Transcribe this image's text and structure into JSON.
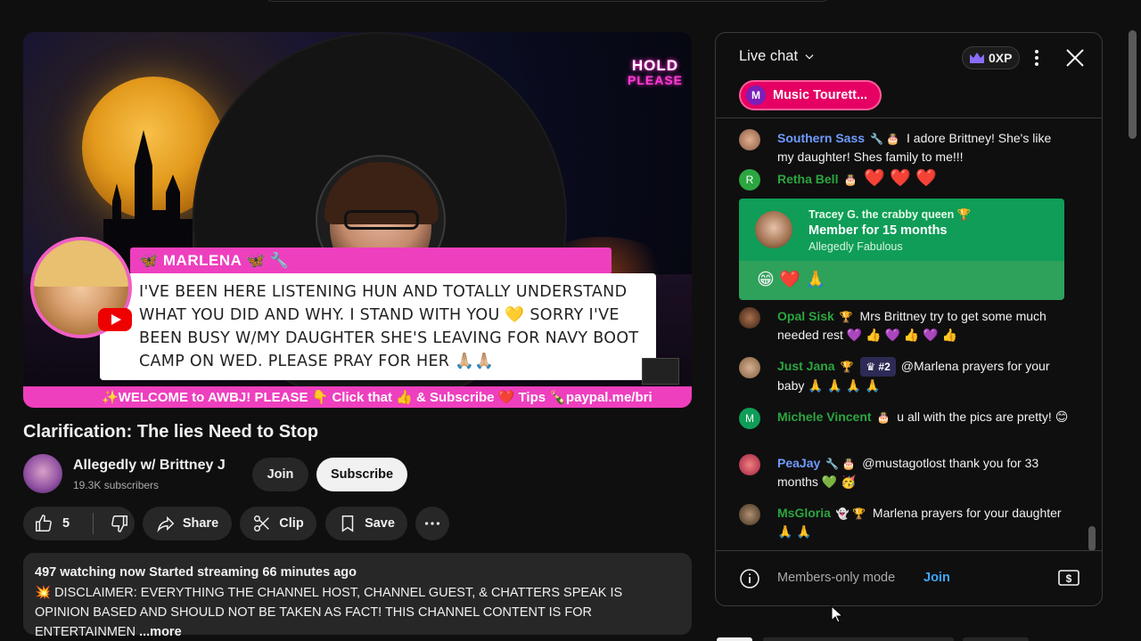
{
  "video": {
    "hold_line1": "HOLD",
    "hold_line2": "PLEASE",
    "overlay_name": "🦋 MARLENA 🦋 🔧",
    "overlay_message": "I'VE BEEN HERE LISTENING HUN AND TOTALLY UNDERSTAND WHAT YOU DID AND WHY. I STAND WITH YOU 💛 SORRY I'VE BEEN BUSY W/MY DAUGHTER SHE'S LEAVING FOR NAVY BOOT CAMP ON WED. PLEASE PRAY FOR HER 🙏🏼🙏🏼",
    "ticker": "✨WELCOME to AWBJ! PLEASE 👇 Click that 👍 & Subscribe ❤️ Tips 🍾paypal.me/bri"
  },
  "title": "Clarification: The lies Need to Stop",
  "channel": {
    "name": "Allegedly w/ Brittney J",
    "subscribers": "19.3K subscribers",
    "join_label": "Join",
    "subscribe_label": "Subscribe"
  },
  "actions": {
    "likes": "5",
    "share_label": "Share",
    "clip_label": "Clip",
    "save_label": "Save"
  },
  "description": {
    "meta": "497 watching now  Started streaming 66 minutes ago",
    "body": "💥 DISCLAIMER: EVERYTHING THE CHANNEL HOST, CHANNEL GUEST, & CHATTERS SPEAK IS OPINION BASED AND SHOULD NOT BE TAKEN AS FACT!  THIS CHANNEL CONTENT IS FOR ENTERTAINMEN",
    "more": "...more"
  },
  "chat": {
    "title": "Live chat",
    "xp": "0XP",
    "pinned": "Music Tourett...",
    "pinned_initial": "M",
    "messages": [
      {
        "author": "Southern Sass",
        "badges": "🔧 🎂",
        "text": "I adore Brittney! She's like my daughter! Shes family to me!!!"
      },
      {
        "author": "Retha Bell",
        "badges": "🎂",
        "text": "❤️ ❤️ ❤️",
        "initial": "R"
      },
      {
        "author": "Opal Sisk",
        "badges": "🏆",
        "text": "Mrs Brittney try to get some much needed rest 💜 👍 💜 👍 💜 👍"
      },
      {
        "author": "Just Jana",
        "badges": "🏆",
        "rank": "#2",
        "text": "@Marlena prayers for your baby 🙏 🙏 🙏 🙏"
      },
      {
        "author": "Michele Vincent",
        "badges": "🎂",
        "text": "u all with the pics are pretty! 😊",
        "initial": "M"
      },
      {
        "author": "PeaJay",
        "badges": "🔧 🎂",
        "text": "@mustagotlost thank you for 33 months 💚 🥳"
      },
      {
        "author": "MsGloria",
        "badges": "👻 🏆",
        "text": "Marlena prayers for your daughter 🙏 🙏"
      }
    ],
    "member": {
      "name": "Tracey G. the crabby queen 🏆",
      "headline": "Member for 15 months",
      "level": "Allegedly Fabulous",
      "emojis": "😁 ❤️ 🙏"
    },
    "footer_text": "Members-only mode",
    "footer_join": "Join"
  }
}
